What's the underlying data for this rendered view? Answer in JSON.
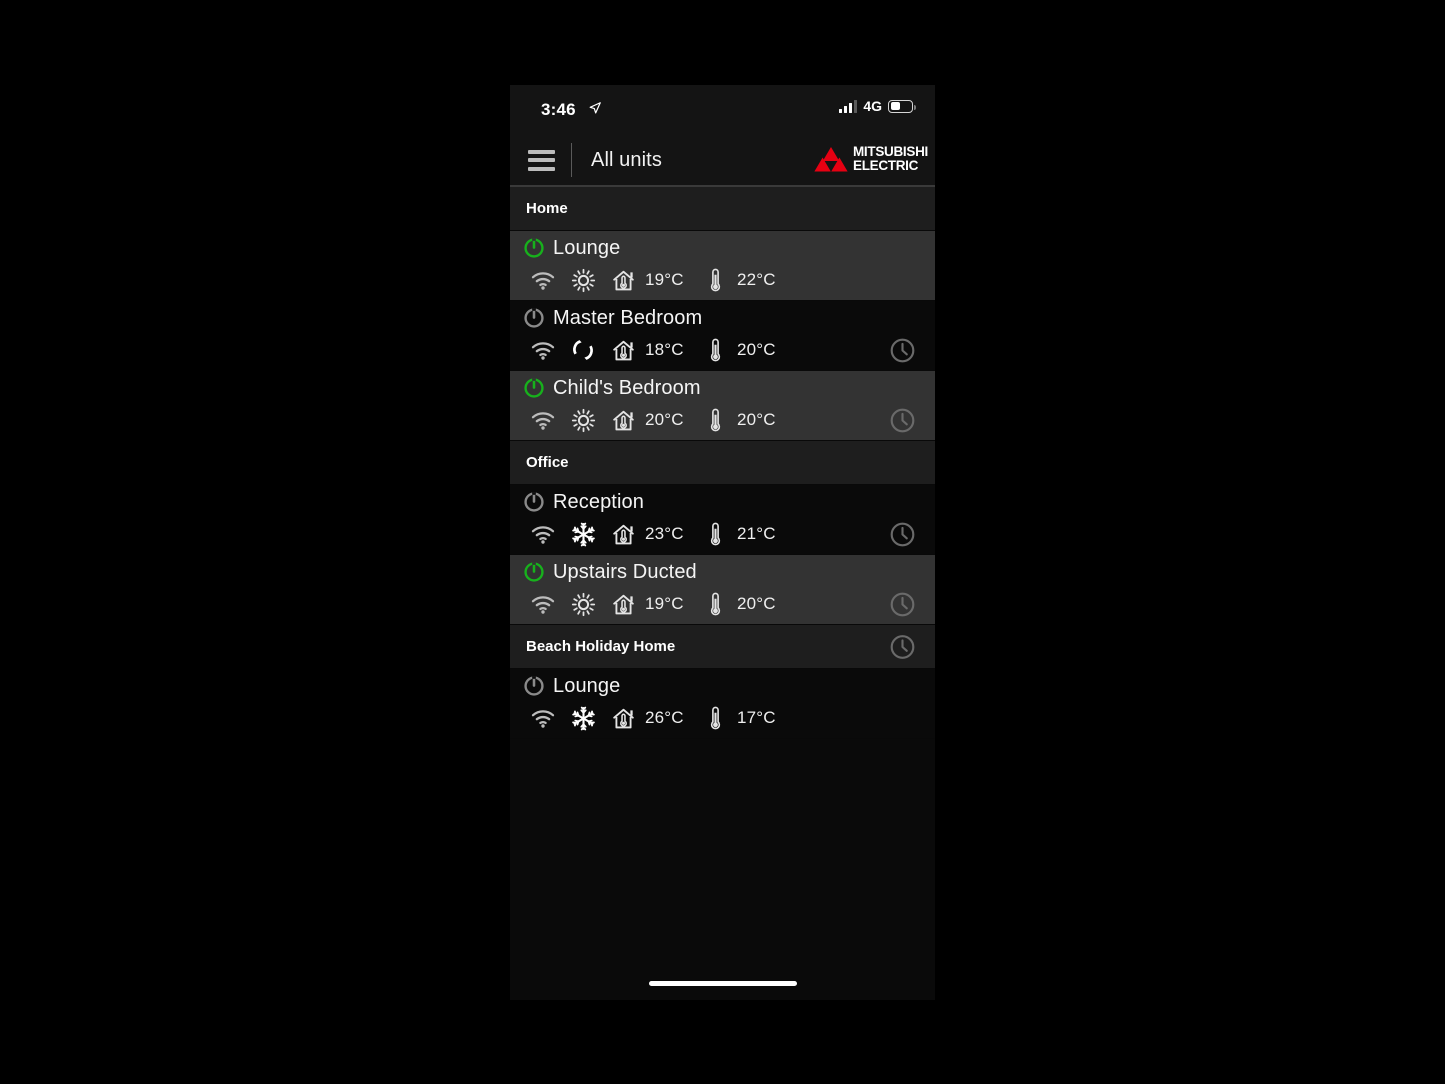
{
  "status_bar": {
    "time": "3:46",
    "location_icon": "location-arrow-icon",
    "signal_icon": "signal-bars-icon",
    "network": "4G",
    "battery_icon": "battery-icon",
    "battery_level_percent": 40
  },
  "app_bar": {
    "menu_icon": "hamburger-menu-icon",
    "title": "All units",
    "brand_line1": "MITSUBISHI",
    "brand_line2": "ELECTRIC",
    "brand_mark": "mitsubishi-diamonds-icon",
    "brand_color": "#e60012"
  },
  "colors": {
    "power_on": "#17b11c",
    "power_off": "#8a8a8a",
    "row_on_bg": "#333333",
    "row_off_bg": "#0a0a0a",
    "group_header_bg": "#1e1e1e",
    "text": "#f5f5f5"
  },
  "groups": [
    {
      "name": "Home",
      "has_schedule": false,
      "units": [
        {
          "name": "Lounge",
          "power": "on",
          "wifi_icon": "wifi-icon",
          "mode": "heat",
          "mode_icon": "sun-icon",
          "room_temp_icon": "house-thermometer-icon",
          "room_temp": "19°C",
          "set_temp_icon": "thermometer-icon",
          "set_temp": "22°C",
          "has_schedule": false
        },
        {
          "name": "Master Bedroom",
          "power": "off",
          "wifi_icon": "wifi-icon",
          "mode": "auto",
          "mode_icon": "auto-cycle-icon",
          "room_temp_icon": "house-thermometer-icon",
          "room_temp": "18°C",
          "set_temp_icon": "thermometer-icon",
          "set_temp": "20°C",
          "has_schedule": true
        },
        {
          "name": "Child's Bedroom",
          "power": "on",
          "wifi_icon": "wifi-icon",
          "mode": "heat",
          "mode_icon": "sun-icon",
          "room_temp_icon": "house-thermometer-icon",
          "room_temp": "20°C",
          "set_temp_icon": "thermometer-icon",
          "set_temp": "20°C",
          "has_schedule": true
        }
      ]
    },
    {
      "name": "Office",
      "has_schedule": false,
      "units": [
        {
          "name": "Reception",
          "power": "off",
          "wifi_icon": "wifi-icon",
          "mode": "cool",
          "mode_icon": "snowflake-icon",
          "room_temp_icon": "house-thermometer-icon",
          "room_temp": "23°C",
          "set_temp_icon": "thermometer-icon",
          "set_temp": "21°C",
          "has_schedule": true
        },
        {
          "name": "Upstairs Ducted",
          "power": "on",
          "wifi_icon": "wifi-icon",
          "mode": "heat",
          "mode_icon": "sun-icon",
          "room_temp_icon": "house-thermometer-icon",
          "room_temp": "19°C",
          "set_temp_icon": "thermometer-icon",
          "set_temp": "20°C",
          "has_schedule": true
        }
      ]
    },
    {
      "name": "Beach Holiday Home",
      "has_schedule": true,
      "units": [
        {
          "name": "Lounge",
          "power": "off",
          "wifi_icon": "wifi-icon",
          "mode": "cool",
          "mode_icon": "snowflake-icon",
          "room_temp_icon": "house-thermometer-icon",
          "room_temp": "26°C",
          "set_temp_icon": "thermometer-icon",
          "set_temp": "17°C",
          "has_schedule": false
        }
      ]
    }
  ],
  "home_indicator": "home-indicator-bar"
}
